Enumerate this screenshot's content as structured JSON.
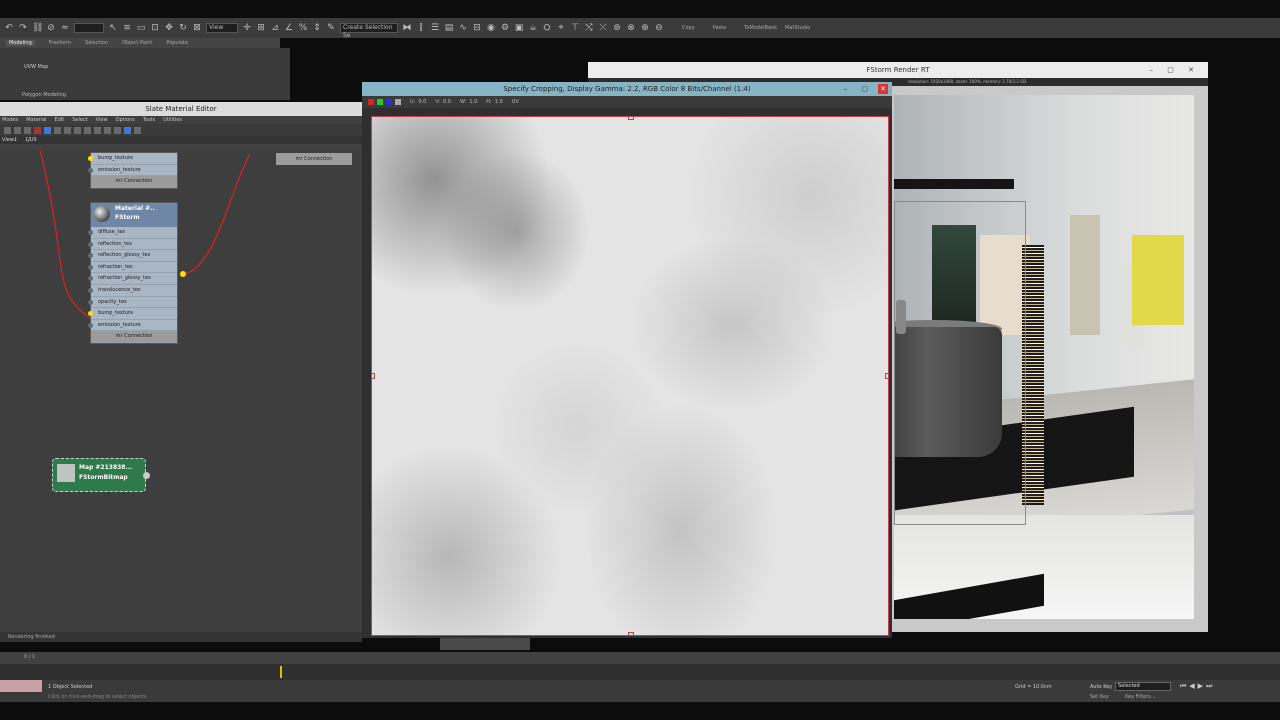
{
  "toolbar": {
    "view_combo": "View",
    "selection_set": "Create Selection Se",
    "copy": "Copy",
    "paste": "Paste",
    "tomodelbank": "ToModelBank",
    "matstudio": "MatStudio"
  },
  "ribbon": {
    "tabs": [
      "Modeling",
      "Freeform",
      "Selection",
      "Object Paint",
      "Populate"
    ],
    "modifier": "UVW Map",
    "label": "Polygon Modeling"
  },
  "slate": {
    "title": "Slate Material Editor",
    "menu": [
      "Modes",
      "Material",
      "Edit",
      "Select",
      "View",
      "Options",
      "Tools",
      "Utilities"
    ],
    "view_tabs": [
      "View1",
      "1JUS"
    ],
    "node_top_slots": [
      "bump_texture",
      "emission_texture"
    ],
    "mr_connection": "mr Connection",
    "material_name": "Material #..",
    "material_type": "FStorm",
    "material_slots": [
      "diffuse_tex",
      "reflection_tex",
      "reflection_glossy_tex",
      "refraction_tex",
      "refraction_glossy_tex",
      "translucence_tex",
      "opacity_tex",
      "bump_texture",
      "emission_texture"
    ],
    "map_name": "Map #213838...",
    "map_type": "FStormBitmap",
    "status": "Rendering finished"
  },
  "crop_window": {
    "title": "Specify Cropping, Display Gamma: 2.2, RGB Color 8 Bits/Channel (1:4)",
    "u_label": "U:",
    "u_value": "0.0",
    "v_label": "V:",
    "v_value": "0.0",
    "w_label": "W:",
    "w_value": "1.0",
    "h_label": "H:",
    "h_value": "1.0",
    "uv": "UV"
  },
  "fstorm": {
    "title": "FStorm Render RT",
    "info": "resolution: 1920x1080, zoom: 100%, memory: 2.70/3.2 GB"
  },
  "timeline": {
    "frame": "0 / 1"
  },
  "status": {
    "selected": "1 Object Selected",
    "hint": "Click or click-and-drag to select objects",
    "grid": "Grid = 10.0cm",
    "auto_key": "Auto Key",
    "selected_combo": "Selected",
    "set_key": "Set Key",
    "key_filters": "Key Filters..."
  },
  "colors": {
    "crop_title_bar": "#86b4c4",
    "crop_border": "#c24050",
    "map_node": "#2e7a4a",
    "material_header": "#6f86a6",
    "wire": "#e02020",
    "slot_dot_active": "#ffe000"
  }
}
